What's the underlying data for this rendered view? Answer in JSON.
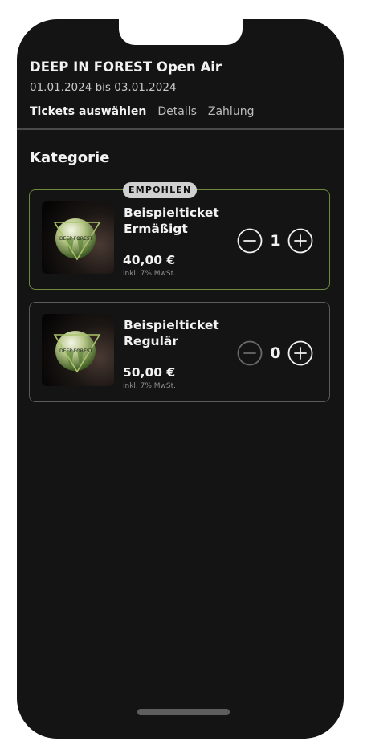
{
  "event": {
    "title": "DEEP IN FOREST Open Air",
    "date_range": "01.01.2024 bis 03.01.2024"
  },
  "steps": [
    {
      "label": "Tickets auswählen",
      "active": true
    },
    {
      "label": "Details",
      "active": false
    },
    {
      "label": "Zahlung",
      "active": false
    }
  ],
  "section_title": "Kategorie",
  "tickets": [
    {
      "badge": "EMPOHLEN",
      "name": "Beispielticket Ermäßigt",
      "price": "40,00 €",
      "tax_note": "inkl. 7% MwSt.",
      "quantity": "1",
      "minus_enabled": true,
      "selected": true,
      "thumbnail_icon": "deep-in-forest-logo-icon"
    },
    {
      "name": "Beispielticket Regulär",
      "price": "50,00 €",
      "tax_note": "inkl. 7% MwSt.",
      "quantity": "0",
      "minus_enabled": false,
      "selected": false,
      "thumbnail_icon": "deep-in-forest-logo-icon"
    }
  ],
  "colors": {
    "background": "#141414",
    "selected_border": "#6f8a3c",
    "badge_background": "#d0d0d0",
    "text_primary": "#f2f2f2"
  }
}
